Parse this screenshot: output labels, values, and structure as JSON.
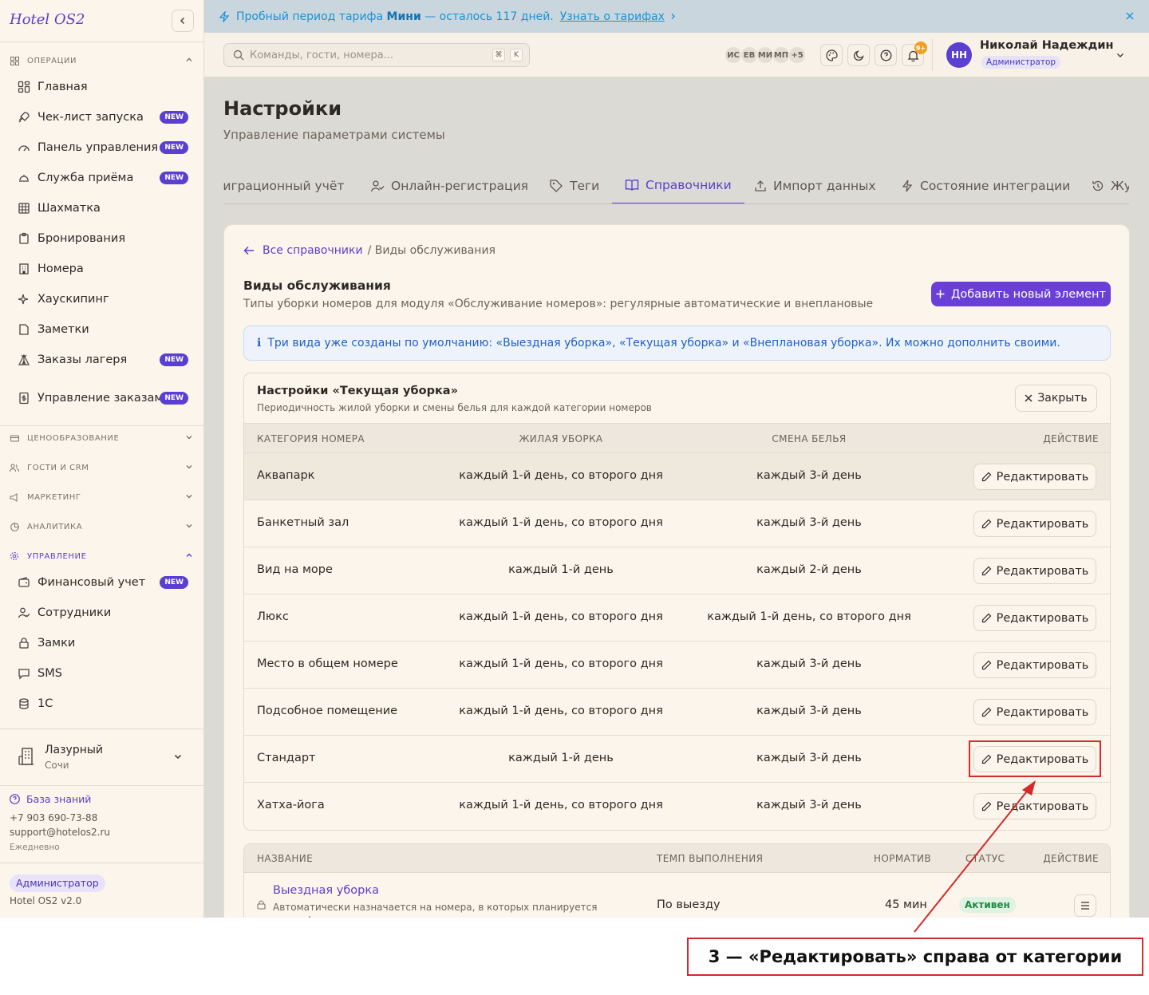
{
  "sidebar": {
    "brand": "Hotel OS2",
    "groups": {
      "operations": "ОПЕРАЦИИ",
      "pricing": "ЦЕНООБРАЗОВАНИЕ",
      "guests": "ГОСТИ И CRM",
      "marketing": "МАРКЕТИНГ",
      "analytics": "АНАЛИТИКА",
      "management": "УПРАВЛЕНИЕ"
    },
    "items": [
      {
        "label": "Главная",
        "icon": "grid-icon"
      },
      {
        "label": "Чек-лист запуска",
        "icon": "rocket-icon",
        "badge": "NEW"
      },
      {
        "label": "Панель управления",
        "icon": "gauge-icon",
        "badge": "NEW"
      },
      {
        "label": "Служба приёма",
        "icon": "bell-desk-icon",
        "badge": "NEW"
      },
      {
        "label": "Шахматка",
        "icon": "table-icon"
      },
      {
        "label": "Бронирования",
        "icon": "clipboard-icon"
      },
      {
        "label": "Номера",
        "icon": "building-icon"
      },
      {
        "label": "Хаускипинг",
        "icon": "sparkle-icon"
      },
      {
        "label": "Заметки",
        "icon": "note-icon"
      },
      {
        "label": "Заказы лагеря",
        "icon": "tent-icon",
        "badge": "NEW"
      },
      {
        "label": "Управление заказами",
        "icon": "dollar-doc-icon",
        "badge": "NEW"
      }
    ],
    "mgmt_items": [
      {
        "label": "Финансовый учет",
        "icon": "wallet-icon",
        "badge": "NEW"
      },
      {
        "label": "Сотрудники",
        "icon": "user-check-icon"
      },
      {
        "label": "Замки",
        "icon": "lock-icon"
      },
      {
        "label": "SMS",
        "icon": "message-icon"
      },
      {
        "label": "1С",
        "icon": "database-icon"
      }
    ],
    "hotel": {
      "name": "Лазурный",
      "city": "Сочи"
    },
    "kb": "База знаний",
    "phone": "+7 903 690-73-88",
    "email": "support@hotelos2.ru",
    "schedule": "Ежедневно",
    "role": "Администратор",
    "version": "Hotel OS2 v2.0"
  },
  "banner": {
    "pre": "Пробный период тарифа ",
    "plan": "Мини",
    "post": " — осталось 117 дней.",
    "link": "Узнать о тарифах"
  },
  "topbar": {
    "search_placeholder": "Команды, гости, номера...",
    "kbd1": "⌘",
    "kbd2": "K",
    "avatars": [
      "ИС",
      "ЕВ",
      "МИ",
      "МП",
      "+5"
    ],
    "notif_count": "9+",
    "user_initials": "НН",
    "user_name": "Николай Надеждин",
    "user_role": "Администратор"
  },
  "page": {
    "title": "Настройки",
    "subtitle": "Управление параметрами системы"
  },
  "tabs": [
    {
      "label": "Миграционный учёт",
      "icon": "passport-icon"
    },
    {
      "label": "Онлайн-регистрация",
      "icon": "user-check-icon"
    },
    {
      "label": "Теги",
      "icon": "tag-icon"
    },
    {
      "label": "Справочники",
      "icon": "book-icon",
      "active": true
    },
    {
      "label": "Импорт данных",
      "icon": "upload-icon"
    },
    {
      "label": "Состояние интеграции",
      "icon": "zap-icon"
    },
    {
      "label": "Журнал",
      "icon": "history-icon"
    }
  ],
  "content": {
    "crumb_back": "Все справочники",
    "crumb_current": "/ Виды обслуживания",
    "title": "Виды обслуживания",
    "subtitle": "Типы уборки номеров для модуля «Обслуживание номеров»: регулярные автоматические и внеплановые",
    "add_button": "Добавить новый элемент",
    "info": "Три вида уже созданы по умолчанию: «Выездная уборка», «Текущая уборка» и «Внеплановая уборка». Их можно дополнить своими."
  },
  "settings_panel": {
    "title": "Настройки «Текущая уборка»",
    "subtitle": "Периодичность жилой уборки и смены белья для каждой категории номеров",
    "close": "Закрыть",
    "columns": [
      "КАТЕГОРИЯ НОМЕРА",
      "ЖИЛАЯ УБОРКА",
      "СМЕНА БЕЛЬЯ",
      "ДЕЙСТВИЕ"
    ],
    "edit_label": "Редактировать",
    "rows": [
      {
        "category": "Аквапарк",
        "cleaning": "каждый 1-й день, со второго дня",
        "linen": "каждый 3-й день"
      },
      {
        "category": "Банкетный зал",
        "cleaning": "каждый 1-й день, со второго дня",
        "linen": "каждый 3-й день"
      },
      {
        "category": "Вид на море",
        "cleaning": "каждый 1-й день",
        "linen": "каждый 2-й день"
      },
      {
        "category": "Люкс",
        "cleaning": "каждый 1-й день, со второго дня",
        "linen": "каждый 1-й день, со второго дня"
      },
      {
        "category": "Место в общем номере",
        "cleaning": "каждый 1-й день, со второго дня",
        "linen": "каждый 3-й день"
      },
      {
        "category": "Подсобное помещение",
        "cleaning": "каждый 1-й день, со второго дня",
        "linen": "каждый 3-й день"
      },
      {
        "category": "Стандарт",
        "cleaning": "каждый 1-й день",
        "linen": "каждый 3-й день"
      },
      {
        "category": "Хатха-йога",
        "cleaning": "каждый 1-й день, со второго дня",
        "linen": "каждый 3-й день"
      }
    ]
  },
  "types_table": {
    "columns": [
      "НАЗВАНИЕ",
      "ТЕМП ВЫПОЛНЕНИЯ",
      "НОРМАТИВ",
      "СТАТУС",
      "ДЕЙСТВИЕ"
    ],
    "row": {
      "name": "Выездная уборка",
      "desc": "Автоматически назначается на номера, в которых планируется или зафиксирован выезд",
      "pace": "По выезду",
      "norm": "45 мин",
      "status": "Активен"
    }
  },
  "annotation": "3 — «Редактировать» справа от категории",
  "colors": {
    "accent": "#5a3fd0",
    "annotation": "#d42a2a",
    "status_active": "#1f8a43"
  }
}
